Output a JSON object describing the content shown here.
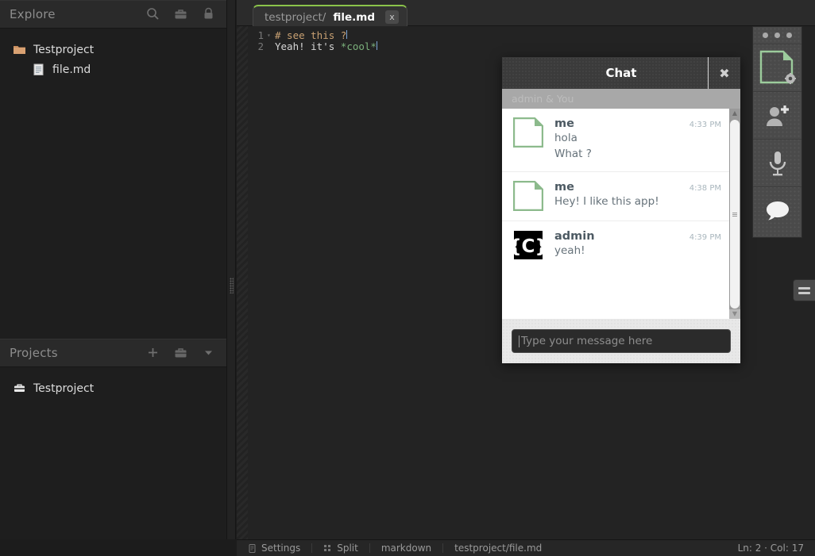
{
  "explorer": {
    "title": "Explore",
    "icons": [
      "search-icon",
      "toolbox-icon",
      "lock-icon"
    ],
    "tree": [
      {
        "label": "Testproject",
        "icon": "folder-icon",
        "depth": 0
      },
      {
        "label": "file.md",
        "icon": "file-icon",
        "depth": 1
      }
    ]
  },
  "projects": {
    "title": "Projects",
    "add_label": "+",
    "icons": [
      "plus-icon",
      "toolbox-icon",
      "chevron-down-icon"
    ],
    "items": [
      {
        "label": "Testproject",
        "icon": "briefcase-icon"
      }
    ]
  },
  "editor": {
    "tab": {
      "directory": "testproject/",
      "filename": "file.md",
      "close_label": "x"
    },
    "lines": [
      {
        "number": "1",
        "fold": "▾",
        "segments": [
          {
            "text": "# see this ?",
            "kind": "heading"
          }
        ]
      },
      {
        "number": "2",
        "fold": "",
        "segments": [
          {
            "text": "Yeah! it's ",
            "kind": "text"
          },
          {
            "text": "*cool*",
            "kind": "em"
          }
        ]
      }
    ]
  },
  "statusbar": {
    "settings_label": "Settings",
    "split_label": "Split",
    "grammar_label": "markdown",
    "path_label": "testproject/file.md",
    "cursor_label": "Ln: 2 · Col: 17"
  },
  "chat": {
    "title": "Chat",
    "close_label": "✖",
    "participants": "admin & You",
    "messages": [
      {
        "author": "me",
        "time": "4:33 PM",
        "avatar": "page-avatar",
        "lines": [
          "hola",
          "What ?"
        ]
      },
      {
        "author": "me",
        "time": "4:38 PM",
        "avatar": "page-avatar",
        "lines": [
          "Hey! I like this app!"
        ]
      },
      {
        "author": "admin",
        "time": "4:39 PM",
        "avatar": "brace-c-avatar",
        "lines": [
          "yeah!"
        ]
      }
    ],
    "input": {
      "placeholder": "Type your message here",
      "value": ""
    },
    "scroll": {
      "up": "▲",
      "down": "▼"
    }
  },
  "rail": {
    "items": [
      {
        "name": "profile-avatar",
        "icon": "page-gear-icon"
      },
      {
        "name": "add-user",
        "icon": "add-person-icon"
      },
      {
        "name": "microphone",
        "icon": "microphone-icon"
      },
      {
        "name": "chat",
        "icon": "chat-bubble-icon"
      }
    ]
  },
  "colors": {
    "accent_green": "#8bc34a",
    "avatar_green": "#8cba8c",
    "heading_orange": "#c9a173",
    "emphasis_green": "#7bb07b"
  }
}
